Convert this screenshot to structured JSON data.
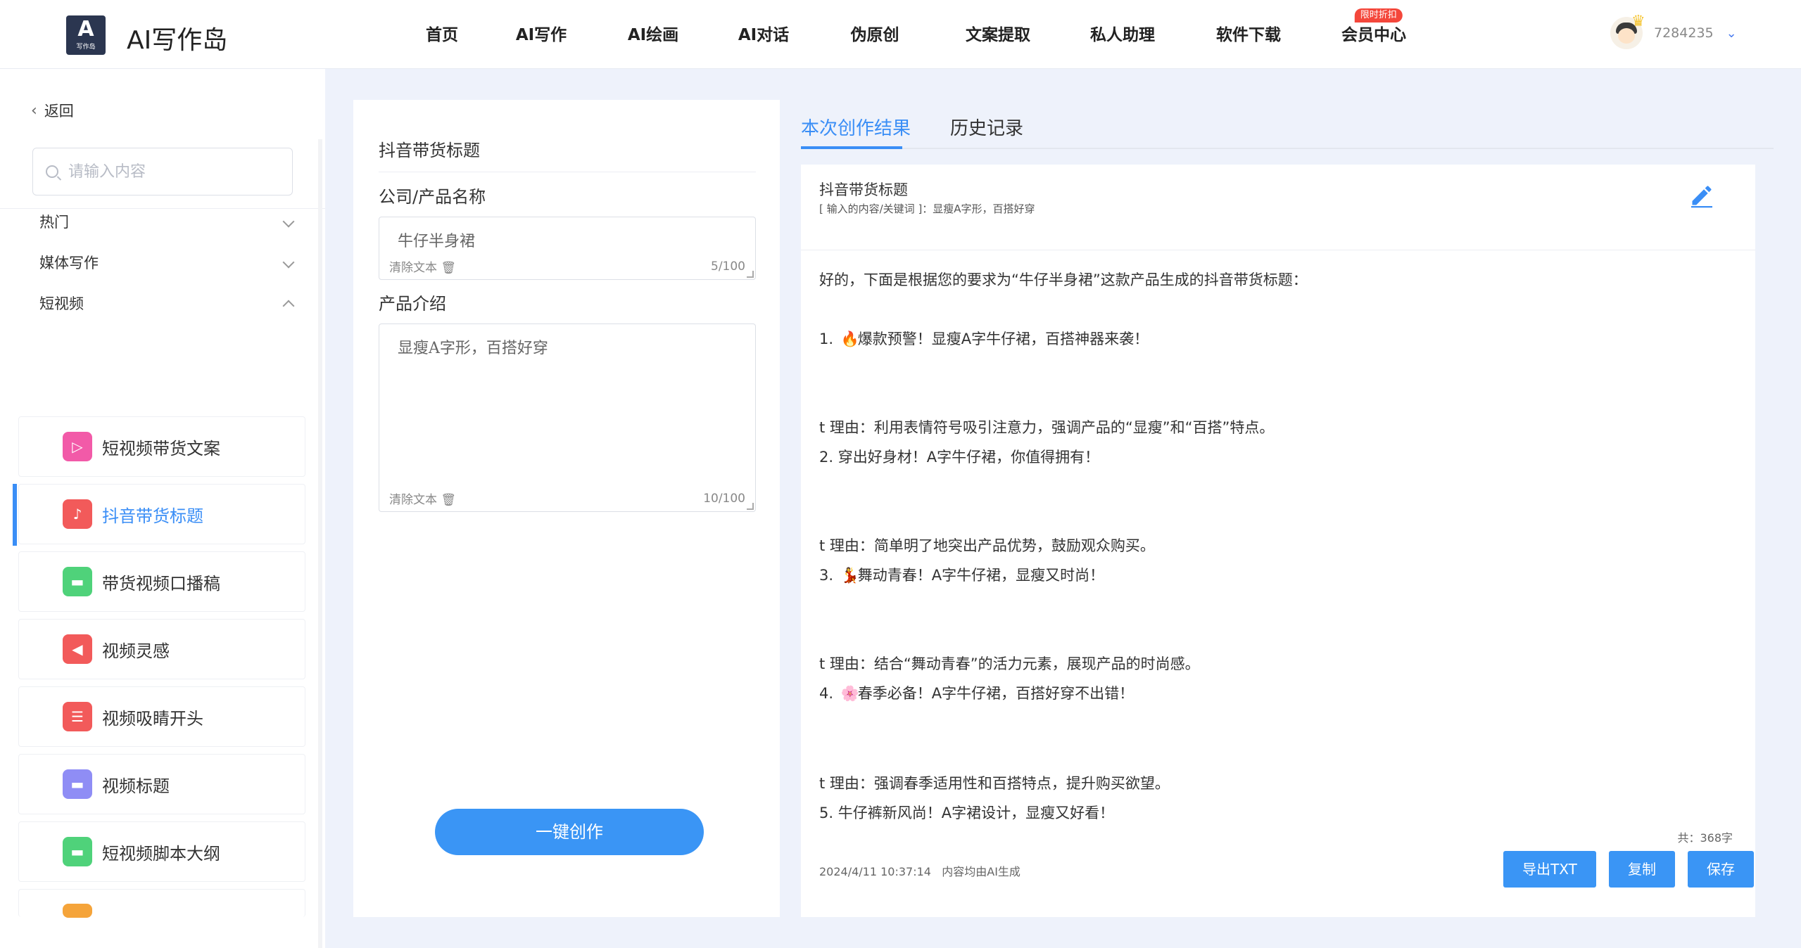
{
  "header": {
    "logo_mark": "A",
    "logo_sub": "写作岛",
    "brand": "AI写作岛",
    "nav": [
      {
        "label": "首页"
      },
      {
        "label": "AI写作"
      },
      {
        "label": "AI绘画"
      },
      {
        "label": "AI对话"
      },
      {
        "label": "伪原创"
      },
      {
        "label": "文案提取"
      },
      {
        "label": "私人助理"
      },
      {
        "label": "软件下载"
      },
      {
        "label": "会员中心",
        "badge": "限时折扣"
      }
    ],
    "user_id": "7284235"
  },
  "sidebar": {
    "back_label": "返回",
    "search_placeholder": "请输入内容",
    "categories": [
      {
        "label": "热门",
        "expanded": false
      },
      {
        "label": "媒体写作",
        "expanded": false
      },
      {
        "label": "短视频",
        "expanded": true
      }
    ],
    "tools": [
      {
        "label": "短视频带货文案",
        "icon": "tv-play-icon",
        "color": "#f25aa8",
        "active": false
      },
      {
        "label": "抖音带货标题",
        "icon": "tiktok-calendar-icon",
        "color": "#f25a5a",
        "active": true
      },
      {
        "label": "带货视频口播稿",
        "icon": "bookmark-doc-icon",
        "color": "#4fd27a",
        "active": false
      },
      {
        "label": "视频灵感",
        "icon": "video-camera-icon",
        "color": "#f25a5a",
        "active": false
      },
      {
        "label": "视频吸睛开头",
        "icon": "calendar-list-icon",
        "color": "#f25a5a",
        "active": false
      },
      {
        "label": "视频标题",
        "icon": "bookmark-doc-icon",
        "color": "#8f8df5",
        "active": false
      },
      {
        "label": "短视频脚本大纲",
        "icon": "bookmark-doc-icon",
        "color": "#4fd27a",
        "active": false
      }
    ]
  },
  "form": {
    "title": "抖音带货标题",
    "fields": [
      {
        "label": "公司/产品名称",
        "value": "牛仔半身裙",
        "clear": "清除文本",
        "count": "5/100"
      },
      {
        "label": "产品介绍",
        "value": "显瘦A字形，百搭好穿",
        "clear": "清除文本",
        "count": "10/100"
      }
    ],
    "submit_label": "一键创作"
  },
  "result": {
    "tabs": [
      "本次创作结果",
      "历史记录"
    ],
    "title": "抖音带货标题",
    "subtitle": "[ 输入的内容/关键词 ]：显瘦A字形，百搭好穿",
    "lines": [
      {
        "text": "好的，下面是根据您的要求为“牛仔半身裙”这款产品生成的抖音带货标题："
      },
      {
        "prefix": "1. ",
        "emoji": "🔥",
        "text": "爆款预警！显瘦A字牛仔裙，百搭神器来袭！"
      },
      {
        "text": "t 理由：利用表情符号吸引注意力，强调产品的“显瘦”和“百搭”特点。"
      },
      {
        "text": "2. 穿出好身材！A字牛仔裙，你值得拥有！"
      },
      {
        "text": "t 理由：简单明了地突出产品优势，鼓励观众购买。"
      },
      {
        "prefix": "3. ",
        "emoji": "💃",
        "text": "舞动青春！A字牛仔裙，显瘦又时尚！"
      },
      {
        "text": "t 理由：结合“舞动青春”的活力元素，展现产品的时尚感。"
      },
      {
        "prefix": "4. ",
        "emoji": "🌸",
        "text": "春季必备！A字牛仔裙，百搭好穿不出错！"
      },
      {
        "text": "t 理由：强调春季适用性和百搭特点，提升购买欲望。"
      },
      {
        "text": "5. 牛仔裤新风尚！A字裙设计，显瘦又好看！"
      }
    ],
    "char_count": "共：368字",
    "timestamp": "2024/4/11 10:37:14",
    "note": "内容均由AI生成",
    "buttons": [
      "导出TXT",
      "复制",
      "保存"
    ]
  },
  "colors": {
    "accent": "#3a8ef6",
    "button": "#3a95f5",
    "badge": "#f4473b",
    "background": "#eef2fb"
  }
}
